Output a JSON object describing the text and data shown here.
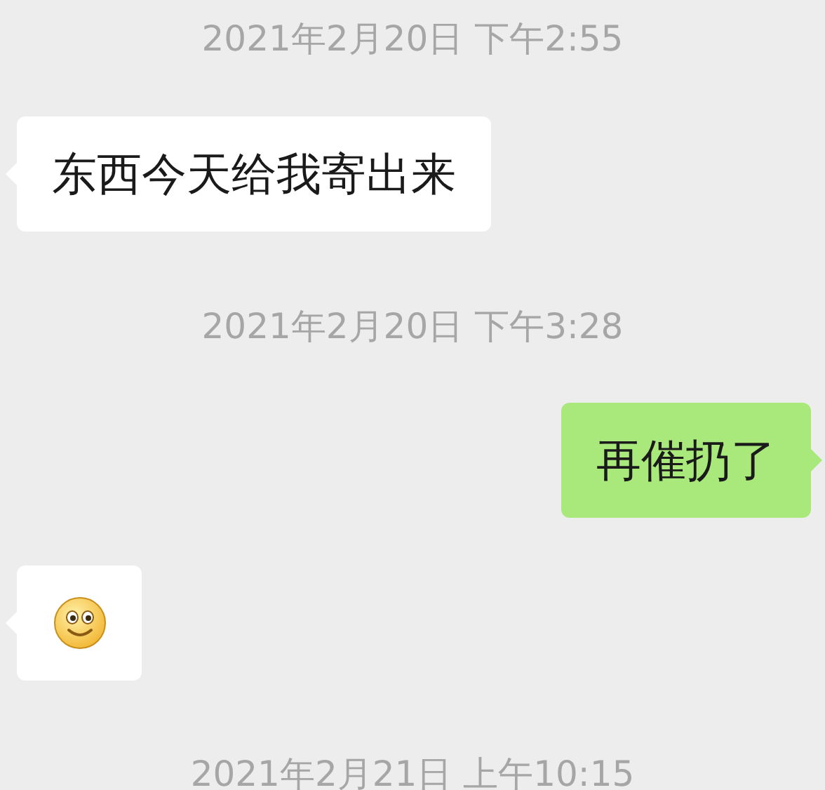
{
  "messages": [
    {
      "kind": "timestamp",
      "text": "2021年2月20日 下午2:55"
    },
    {
      "kind": "text",
      "outgoing": false,
      "text": "东西今天给我寄出来"
    },
    {
      "kind": "timestamp",
      "text": "2021年2月20日 下午3:28"
    },
    {
      "kind": "text",
      "outgoing": true,
      "text": "再催扔了"
    },
    {
      "kind": "emoji",
      "outgoing": false
    },
    {
      "kind": "timestamp",
      "text": "2021年2月21日 上午10:15"
    }
  ]
}
